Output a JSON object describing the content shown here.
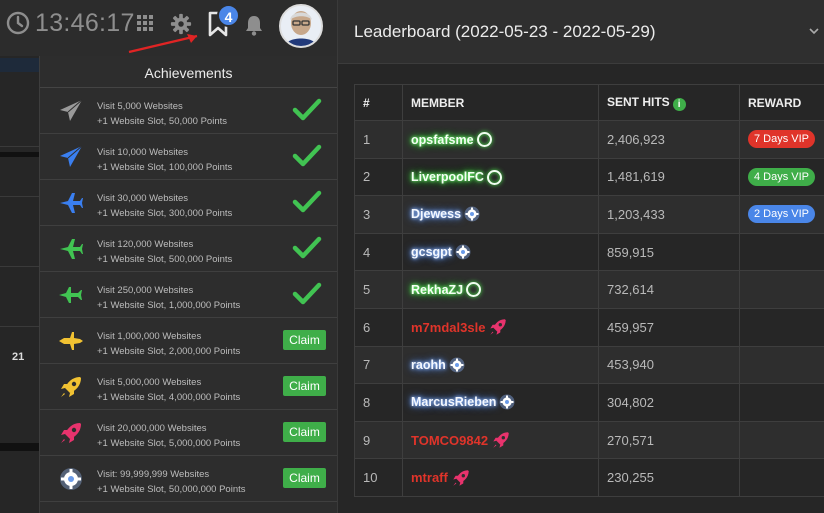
{
  "topbar": {
    "time": "13:46:17",
    "notification_count": "4"
  },
  "strip": {
    "day_label": "21"
  },
  "achievements": {
    "title": "Achievements",
    "items": [
      {
        "line1": "Visit 5,000 Websites",
        "line2": "+1 Website Slot, 50,000 Points",
        "status": "done",
        "icon": "paper-plane-icon",
        "color": "#9a9a9a"
      },
      {
        "line1": "Visit 10,000 Websites",
        "line2": "+1 Website Slot, 100,000 Points",
        "status": "done",
        "icon": "paper-plane-icon",
        "color": "#3a7ff0"
      },
      {
        "line1": "Visit 30,000 Websites",
        "line2": "+1 Website Slot, 300,000 Points",
        "status": "done",
        "icon": "airplane-icon",
        "color": "#3a7ff0"
      },
      {
        "line1": "Visit 120,000 Websites",
        "line2": "+1 Website Slot, 500,000 Points",
        "status": "done",
        "icon": "airplane-icon",
        "color": "#41c352"
      },
      {
        "line1": "Visit 250,000 Websites",
        "line2": "+1 Website Slot, 1,000,000 Points",
        "status": "done",
        "icon": "jet-icon",
        "color": "#41c352"
      },
      {
        "line1": "Visit 1,000,000 Websites",
        "line2": "+1 Website Slot, 2,000,000 Points",
        "status": "claim",
        "icon": "fighter-jet-icon",
        "color": "#f1c232"
      },
      {
        "line1": "Visit 5,000,000 Websites",
        "line2": "+1 Website Slot, 4,000,000 Points",
        "status": "claim",
        "icon": "rocket-icon",
        "color": "#f1c232"
      },
      {
        "line1": "Visit 20,000,000 Websites",
        "line2": "+1 Website Slot, 5,000,000 Points",
        "status": "claim",
        "icon": "rocket-icon",
        "color": "#e8336d"
      },
      {
        "line1": "Visit: 99,999,999 Websites",
        "line2": "+1 Website Slot, 50,000,000 Points",
        "status": "claim",
        "icon": "glowing-cog-icon",
        "color": "#ffffff"
      }
    ],
    "claim_label": "Claim"
  },
  "leaderboard": {
    "title": "Leaderboard (2022-05-23 - 2022-05-29)",
    "columns": [
      "#",
      "MEMBER",
      "SENT HITS",
      "REWARD"
    ],
    "rows": [
      {
        "rank": "1",
        "member": "opsfafsme",
        "style": "green",
        "badge": "ring",
        "hits": "2,406,923",
        "reward": "7 Days VIP",
        "reward_color": "#e0342a"
      },
      {
        "rank": "2",
        "member": "LiverpoolFC",
        "style": "green",
        "badge": "ring",
        "hits": "1,481,619",
        "reward": "4 Days VIP",
        "reward_color": "#3fae49"
      },
      {
        "rank": "3",
        "member": "Djewess",
        "style": "blue",
        "badge": "cog",
        "hits": "1,203,433",
        "reward": "2 Days VIP",
        "reward_color": "#4a86e8"
      },
      {
        "rank": "4",
        "member": "gcsgpt",
        "style": "blue",
        "badge": "cog",
        "hits": "859,915",
        "reward": "",
        "reward_color": ""
      },
      {
        "rank": "5",
        "member": "RekhaZJ",
        "style": "green",
        "badge": "ring",
        "hits": "732,614",
        "reward": "",
        "reward_color": ""
      },
      {
        "rank": "6",
        "member": "m7mdal3sle",
        "style": "red",
        "badge": "rocket",
        "hits": "459,957",
        "reward": "",
        "reward_color": ""
      },
      {
        "rank": "7",
        "member": "raohh",
        "style": "blue",
        "badge": "cog",
        "hits": "453,940",
        "reward": "",
        "reward_color": ""
      },
      {
        "rank": "8",
        "member": "MarcusRieben",
        "style": "blue",
        "badge": "cog",
        "hits": "304,802",
        "reward": "",
        "reward_color": ""
      },
      {
        "rank": "9",
        "member": "TOMCO9842",
        "style": "red",
        "badge": "rocket",
        "hits": "270,571",
        "reward": "",
        "reward_color": ""
      },
      {
        "rank": "10",
        "member": "mtraff",
        "style": "red",
        "badge": "rocket",
        "hits": "230,255",
        "reward": "",
        "reward_color": ""
      }
    ]
  }
}
